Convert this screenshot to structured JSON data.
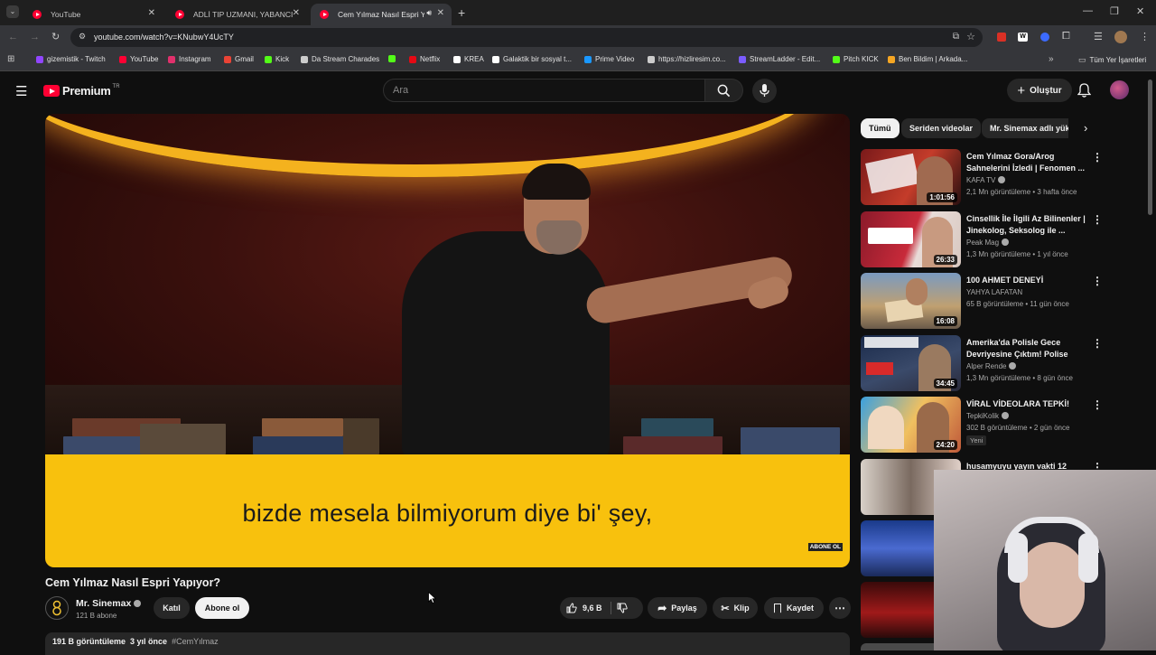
{
  "browser": {
    "tabs": [
      {
        "title": "YouTube",
        "active": false
      },
      {
        "title": "ADLİ TIP UZMANI, YABANCI D...",
        "active": false
      },
      {
        "title": "Cem Yılmaz Nasıl Espri Yapı",
        "active": true
      }
    ],
    "url": "youtube.com/watch?v=KNubwY4UcTY",
    "bookmarks": [
      {
        "label": "gizemistik - Twitch",
        "color": "#9146ff"
      },
      {
        "label": "YouTube",
        "color": "#ff0033"
      },
      {
        "label": "Instagram",
        "color": "#e1306c"
      },
      {
        "label": "Gmail",
        "color": "#ea4335"
      },
      {
        "label": "Kick",
        "color": "#53fc18"
      },
      {
        "label": "Da Stream Charades",
        "color": "#cccccc"
      },
      {
        "label": "",
        "color": "#53fc18"
      },
      {
        "label": "Netflix",
        "color": "#e50914"
      },
      {
        "label": "KREA",
        "color": "#ffffff"
      },
      {
        "label": "Galaktik bir sosyal t...",
        "color": "#ffffff"
      },
      {
        "label": "Prime Video",
        "color": "#1a98ff"
      },
      {
        "label": "https://hizliresim.co...",
        "color": "#cccccc"
      },
      {
        "label": "StreamLadder - Edit...",
        "color": "#7b5cff"
      },
      {
        "label": "Pitch KICK",
        "color": "#53fc18"
      },
      {
        "label": "Ben Bildim | Arkada...",
        "color": "#f5a623"
      }
    ],
    "all_bookmarks": "Tüm Yer İşaretleri"
  },
  "youtube": {
    "logo": "Premium",
    "region": "TR",
    "search_placeholder": "Ara",
    "create_label": "Oluştur"
  },
  "video": {
    "caption": "bizde mesela bilmiyorum diye bi' şey,",
    "watermark": "ABONE OL",
    "title": "Cem Yılmaz Nasıl Espri Yapıyor?",
    "channel": "Mr. Sinemax",
    "subscribers": "121 B abone",
    "join_label": "Katıl",
    "subscribe_label": "Abone ol",
    "likes": "9,6 B",
    "share_label": "Paylaş",
    "clip_label": "Klip",
    "save_label": "Kaydet",
    "views": "191 B görüntüleme",
    "age": "3 yıl önce",
    "hashtag": "#CemYılmaz"
  },
  "sidebar": {
    "chips": [
      {
        "label": "Tümü",
        "selected": true
      },
      {
        "label": "Seriden videolar",
        "selected": false
      },
      {
        "label": "Mr. Sinemax adlı yük",
        "selected": false
      }
    ],
    "videos": [
      {
        "title": "Cem Yılmaz Gora/Arog Sahnelerini İzledi | Fenomen ...",
        "channel": "KAFA TV",
        "meta": "2,1 Mn görüntüleme • 3 hafta önce",
        "duration": "1:01:56",
        "new": ""
      },
      {
        "title": "Cinsellik İle İlgili Az Bilinenler | Jinekolog, Seksolog ile ...",
        "channel": "Peak Mag",
        "meta": "1,3 Mn görüntüleme • 1 yıl önce",
        "duration": "26:33",
        "new": ""
      },
      {
        "title": "100 AHMET DENEYİ",
        "channel": "YAHYA LAFATAN",
        "meta": "65 B görüntüleme • 11 gün önce",
        "duration": "16:08",
        "new": ""
      },
      {
        "title": "Amerika'da Polisle Gece Devriyesine Çıktım! Polise Küf...",
        "channel": "Alper Rende",
        "meta": "1,3 Mn görüntüleme • 8 gün önce",
        "duration": "34:45",
        "new": ""
      },
      {
        "title": "VİRAL VİDEOLARA TEPKİ!",
        "channel": "TepkiKolik",
        "meta": "302 B görüntüleme • 2 gün önce",
        "duration": "24:20",
        "new": "Yeni"
      },
      {
        "title": "husamyuyu yayın vakti 12",
        "channel": "",
        "meta": "",
        "duration": "",
        "new": ""
      }
    ]
  }
}
